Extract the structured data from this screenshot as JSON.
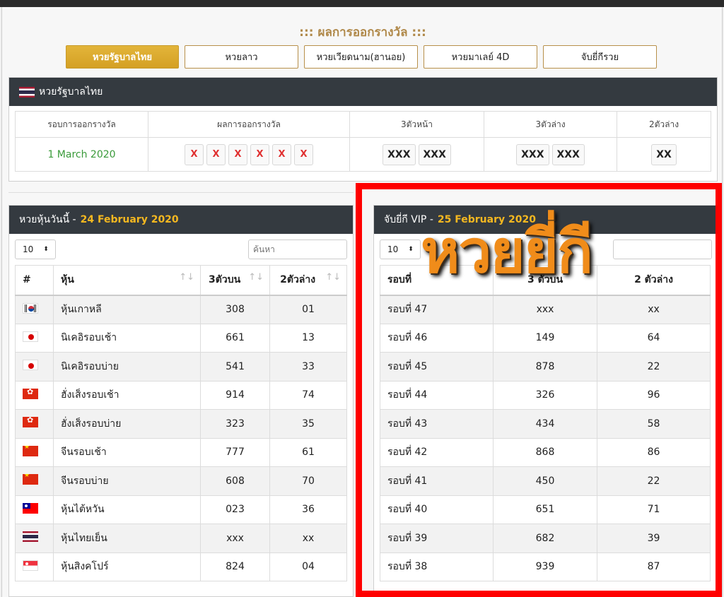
{
  "main_title": "::: ผลการออกรางวัล :::",
  "tabs": [
    {
      "label": "หวยรัฐบาลไทย"
    },
    {
      "label": "หวยลาว"
    },
    {
      "label": "หวยเวียดนาม(ฮานอย)"
    },
    {
      "label": "หวยมาเลย์ 4D"
    },
    {
      "label": "จับยี่กีรวย"
    }
  ],
  "thai_panel": {
    "title": "หวยรัฐบาลไทย",
    "headers": [
      "รอบการออกรางวัล",
      "ผลการออกรางวัล",
      "3ตัวหน้า",
      "3ตัวล่าง",
      "2ตัวล่าง"
    ],
    "round_date": "1 March 2020",
    "result_digits": [
      "X",
      "X",
      "X",
      "X",
      "X",
      "X"
    ],
    "front3": [
      "XXX",
      "XXX"
    ],
    "back3": [
      "XXX",
      "XXX"
    ],
    "back2": [
      "XX"
    ]
  },
  "stock_panel": {
    "title": "หวยหุ้นวันนี้ -",
    "date": "24 February 2020",
    "page_size": "10",
    "search_placeholder": "ค้นหา",
    "headers": [
      "#",
      "หุ้น",
      "3ตัวบน",
      "2ตัวล่าง"
    ],
    "rows": [
      {
        "flag": "kr",
        "name": "หุ้นเกาหลี",
        "top3": "308",
        "bottom2": "01"
      },
      {
        "flag": "jp",
        "name": "นิเคอิรอบเช้า",
        "top3": "661",
        "bottom2": "13"
      },
      {
        "flag": "jp",
        "name": "นิเคอิรอบบ่าย",
        "top3": "541",
        "bottom2": "33"
      },
      {
        "flag": "hk",
        "name": "ฮั่งเส็งรอบเช้า",
        "top3": "914",
        "bottom2": "74"
      },
      {
        "flag": "hk",
        "name": "ฮั่งเส็งรอบบ่าย",
        "top3": "323",
        "bottom2": "35"
      },
      {
        "flag": "cn",
        "name": "จีนรอบเช้า",
        "top3": "777",
        "bottom2": "61"
      },
      {
        "flag": "cn",
        "name": "จีนรอบบ่าย",
        "top3": "608",
        "bottom2": "70"
      },
      {
        "flag": "tw",
        "name": "หุ้นไต้หวัน",
        "top3": "023",
        "bottom2": "36"
      },
      {
        "flag": "th",
        "name": "หุ้นไทยเย็น",
        "top3": "xxx",
        "bottom2": "xx"
      },
      {
        "flag": "sg",
        "name": "หุ้นสิงคโปร์",
        "top3": "824",
        "bottom2": "04"
      }
    ]
  },
  "yiki_panel": {
    "title": "จับยี่กี VIP -",
    "date": "25 February 2020",
    "page_size": "10",
    "headers": [
      "รอบที่",
      "3 ตัวบน",
      "2 ตัวล่าง"
    ],
    "rows": [
      {
        "round": "รอบที่ 47",
        "top3": "xxx",
        "bottom2": "xx"
      },
      {
        "round": "รอบที่ 46",
        "top3": "149",
        "bottom2": "64"
      },
      {
        "round": "รอบที่ 45",
        "top3": "878",
        "bottom2": "22"
      },
      {
        "round": "รอบที่ 44",
        "top3": "326",
        "bottom2": "96"
      },
      {
        "round": "รอบที่ 43",
        "top3": "434",
        "bottom2": "58"
      },
      {
        "round": "รอบที่ 42",
        "top3": "868",
        "bottom2": "86"
      },
      {
        "round": "รอบที่ 41",
        "top3": "450",
        "bottom2": "22"
      },
      {
        "round": "รอบที่ 40",
        "top3": "651",
        "bottom2": "71"
      },
      {
        "round": "รอบที่ 39",
        "top3": "682",
        "bottom2": "39"
      },
      {
        "round": "รอบที่ 38",
        "top3": "939",
        "bottom2": "87"
      }
    ]
  },
  "overlay_text": "หวยยี่กี",
  "colors": {
    "accent": "#d4a024",
    "header": "#343a40",
    "date_highlight": "#f5b820",
    "frame": "#ff0000",
    "overlay": "#f08c1a",
    "round_date": "#3a9a3a"
  }
}
